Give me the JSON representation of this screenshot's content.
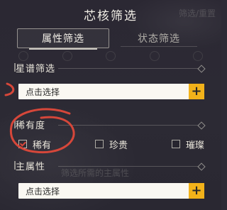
{
  "dialog": {
    "title": "芯核筛选",
    "ghost_title": "筛选/重置"
  },
  "tabs": [
    {
      "label": "属性筛选",
      "active": true
    },
    {
      "label": "状态筛选",
      "active": false
    }
  ],
  "sections": {
    "star": {
      "label": "星谱筛选",
      "select_text": "点击选择"
    },
    "rarity": {
      "label": "稀有度",
      "options": [
        {
          "label": "稀有",
          "checked": true
        },
        {
          "label": "珍贵",
          "checked": false
        },
        {
          "label": "璀璨",
          "checked": false
        }
      ]
    },
    "main_attr": {
      "label": "主属性",
      "select_text": "点击选择",
      "ghost_hint": "筛选所需的主属性"
    }
  },
  "icons": {
    "plus": "+",
    "check": "check-icon",
    "section_end": "diamond-icon"
  },
  "colors": {
    "background": "#2c2a34",
    "accent_yellow": "#f2b21a",
    "annotation_red": "#d6473a",
    "text_light": "#ece8dd"
  }
}
